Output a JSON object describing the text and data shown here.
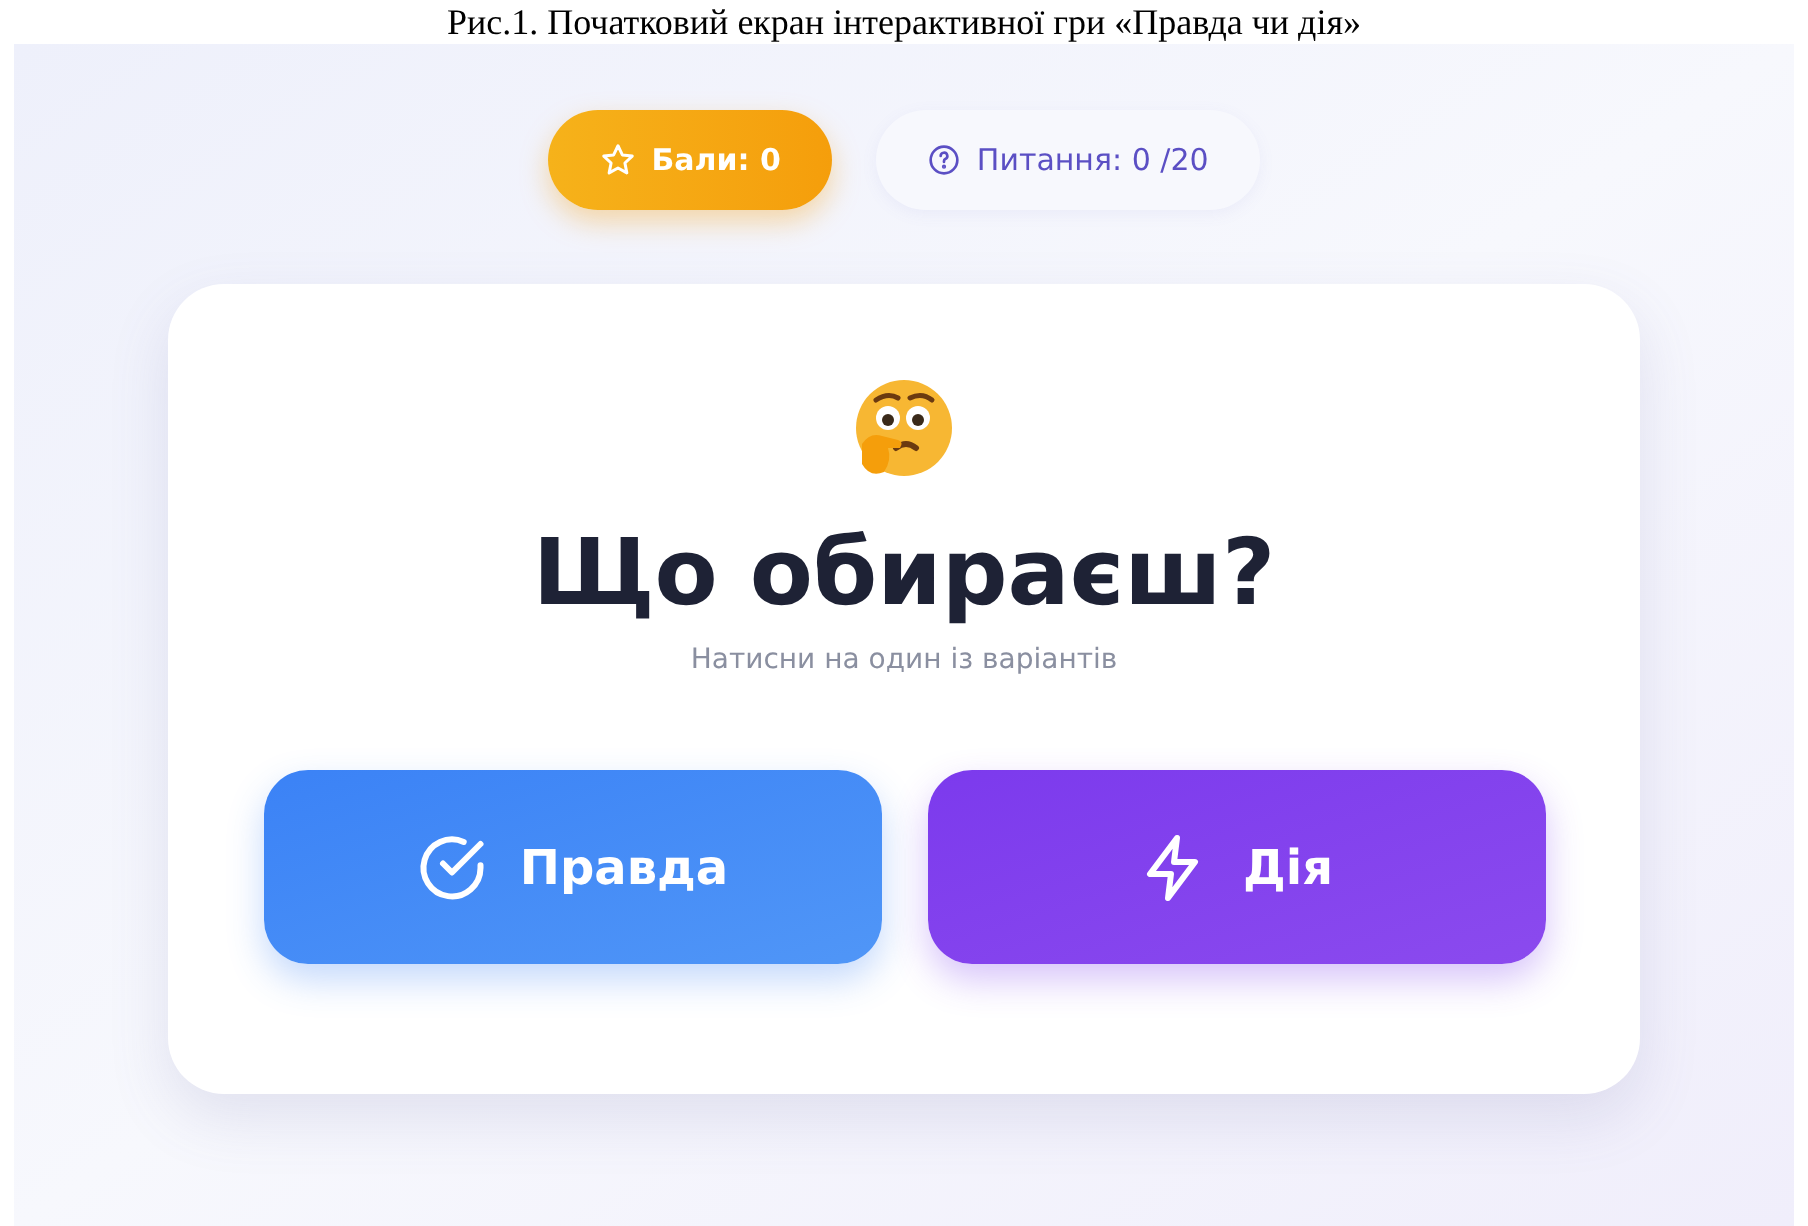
{
  "caption": "Рис.1. Початковий екран інтерактивної гри «Правда чи дія»",
  "badges": [
    {
      "kind": "score",
      "label": "Бали: 0"
    },
    {
      "kind": "questions",
      "label": "Питання: 0 /20"
    }
  ],
  "card": {
    "title": "Що обираєш?",
    "subtitle": "Натисни на один із варіантів",
    "choices": [
      {
        "kind": "truth",
        "label": "Правда"
      },
      {
        "kind": "dare",
        "label": "Дія"
      }
    ]
  }
}
